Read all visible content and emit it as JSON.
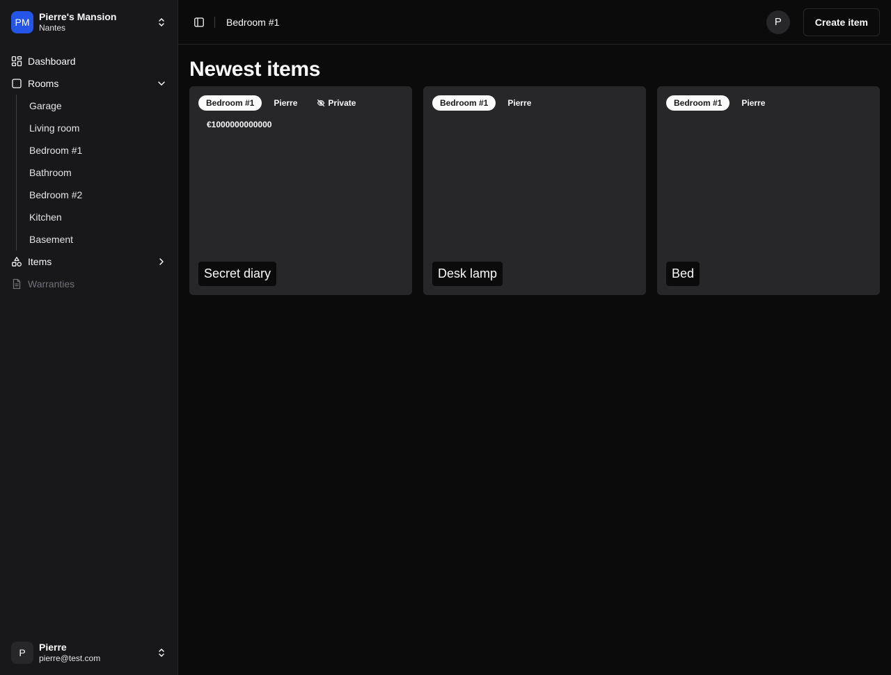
{
  "workspace": {
    "initials": "PM",
    "name": "Pierre's Mansion",
    "location": "Nantes"
  },
  "nav": {
    "dashboard": "Dashboard",
    "rooms": "Rooms",
    "rooms_sub": [
      "Garage",
      "Living room",
      "Bedroom #1",
      "Bathroom",
      "Bedroom #2",
      "Kitchen",
      "Basement"
    ],
    "items": "Items",
    "warranties": "Warranties"
  },
  "user": {
    "initial": "P",
    "name": "Pierre",
    "email": "pierre@test.com"
  },
  "header": {
    "breadcrumb": "Bedroom #1",
    "avatar_initial": "P",
    "create_label": "Create item"
  },
  "main": {
    "title": "Newest items"
  },
  "cards": [
    {
      "room": "Bedroom #1",
      "owner": "Pierre",
      "private_label": "Private",
      "price": "€1000000000000",
      "title": "Secret diary"
    },
    {
      "room": "Bedroom #1",
      "owner": "Pierre",
      "title": "Desk lamp"
    },
    {
      "room": "Bedroom #1",
      "owner": "Pierre",
      "title": "Bed"
    }
  ],
  "colors": {
    "accent": "#2555e6",
    "background": "#0b0b0c",
    "sidebar": "#18181b",
    "card": "#27272a"
  }
}
